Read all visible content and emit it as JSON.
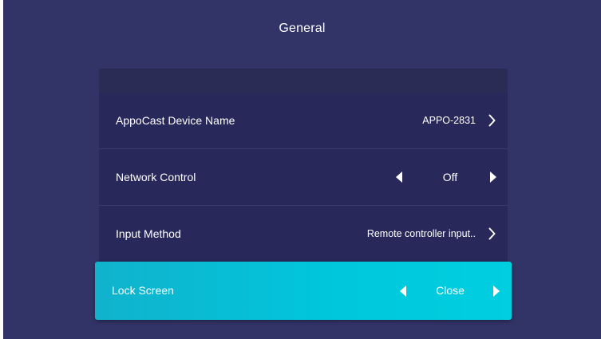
{
  "page": {
    "title": "General"
  },
  "settings": [
    {
      "label": "AppoCast Device Name",
      "value": "APPO-2831",
      "control": "link"
    },
    {
      "label": "Network Control",
      "value": "Off",
      "control": "toggle"
    },
    {
      "label": "Input Method",
      "value": "Remote controller input..",
      "control": "link"
    },
    {
      "label": "Lock Screen",
      "value": "Close",
      "control": "toggle",
      "focused": true
    }
  ],
  "colors": {
    "background": "#323468",
    "row": "#28295a",
    "focus_accent": "#00c6dc",
    "text": "#ffffff"
  }
}
